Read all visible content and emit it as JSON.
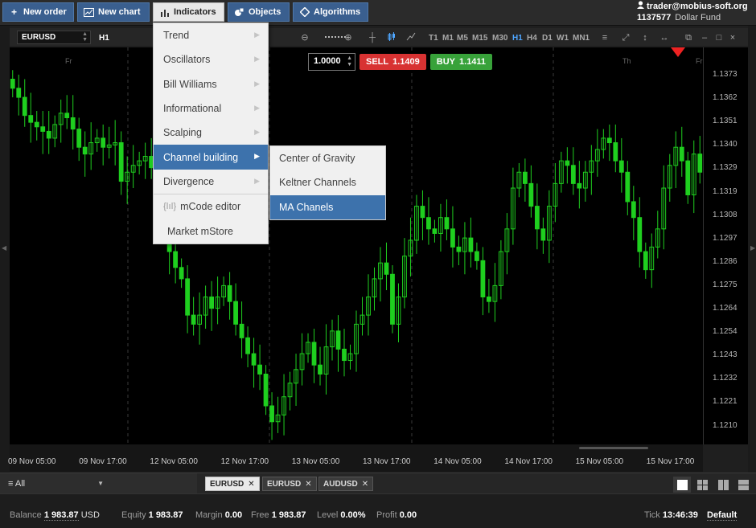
{
  "toolbar": {
    "buttons": [
      {
        "label": "New order",
        "icon": "plus-icon"
      },
      {
        "label": "New chart",
        "icon": "chart-icon"
      },
      {
        "label": "Indicators",
        "icon": "bar-chart-icon"
      },
      {
        "label": "Objects",
        "icon": "objects-icon"
      },
      {
        "label": "Algorithms",
        "icon": "diamond-icon"
      }
    ],
    "user_email": "trader@mobius-soft.org",
    "account_number": "1137577",
    "account_name": "Dollar Fund"
  },
  "chart": {
    "symbol": "EURUSD",
    "timeframe": "H1",
    "timeframes": [
      "T1",
      "M1",
      "M5",
      "M15",
      "M30",
      "H1",
      "H4",
      "D1",
      "W1",
      "MN1"
    ],
    "selected_timeframe": "H1",
    "quantity": "1.0000",
    "sell_label": "SELL",
    "sell_price": "1.1409",
    "buy_label": "BUY",
    "buy_price": "1.1411",
    "price_ticks": [
      "1.1373",
      "1.1362",
      "1.1351",
      "1.1340",
      "1.1329",
      "1.1319",
      "1.1308",
      "1.1297",
      "1.1286",
      "1.1275",
      "1.1264",
      "1.1254",
      "1.1243",
      "1.1232",
      "1.1221",
      "1.1210"
    ],
    "time_ticks": [
      "09 Nov 05:00",
      "09 Nov 17:00",
      "12 Nov 05:00",
      "12 Nov 17:00",
      "13 Nov 05:00",
      "13 Nov 17:00",
      "14 Nov 05:00",
      "14 Nov 17:00",
      "15 Nov 05:00",
      "15 Nov 17:00"
    ],
    "day_labels": [
      "Fr",
      "Th",
      "Fr"
    ],
    "candle_color": "#1fcf1f",
    "background_color": "#000000",
    "sell_color": "#d83232",
    "buy_color": "#38a23a"
  },
  "indicators_menu": {
    "items": [
      {
        "label": "Trend",
        "has_submenu": true
      },
      {
        "label": "Oscillators",
        "has_submenu": true
      },
      {
        "label": "Bill Williams",
        "has_submenu": true
      },
      {
        "label": "Informational",
        "has_submenu": true
      },
      {
        "label": "Scalping",
        "has_submenu": true
      },
      {
        "label": "Channel building",
        "has_submenu": true
      },
      {
        "label": "Divergence",
        "has_submenu": true
      }
    ],
    "highlighted": "Channel building",
    "mcode_label": "mCode editor",
    "mstore_label": "Market mStore",
    "submenu": [
      "Center of Gravity",
      "Keltner Channels",
      "MA Chanels"
    ],
    "submenu_highlighted": "MA Chanels"
  },
  "tabs": {
    "filter": "All",
    "symbols": [
      "EURUSD",
      "EURUSD",
      "AUDUSD"
    ],
    "selected_index": 0
  },
  "status": {
    "balance_label": "Balance",
    "balance": "1 983.87",
    "currency": "USD",
    "equity_label": "Equity",
    "equity": "1 983.87",
    "margin_label": "Margin",
    "margin": "0.00",
    "free_label": "Free",
    "free": "1 983.87",
    "level_label": "Level",
    "level": "0.00%",
    "profit_label": "Profit",
    "profit": "0.00",
    "tick_label": "Tick",
    "tick_time": "13:46:39",
    "profile": "Default"
  },
  "chart_data": {
    "type": "candlestick",
    "candles_close": [
      1.1362,
      1.1358,
      1.135,
      1.1347,
      1.1345,
      1.1343,
      1.134,
      1.1346,
      1.1351,
      1.1349,
      1.1344,
      1.1336,
      1.1333,
      1.1338,
      1.134,
      1.1336,
      1.1337,
      1.1338,
      1.1321,
      1.1325,
      1.1328,
      1.133,
      1.1332,
      1.1327,
      1.1322,
      1.13,
      1.129,
      1.1283,
      1.1278,
      1.1262,
      1.1258,
      1.1262,
      1.127,
      1.1265,
      1.127,
      1.1275,
      1.1268,
      1.1258,
      1.1252,
      1.1245,
      1.124,
      1.1236,
      1.1222,
      1.1215,
      1.1218,
      1.1226,
      1.1232,
      1.1238,
      1.1245,
      1.125,
      1.124,
      1.1236,
      1.1248,
      1.1255,
      1.1247,
      1.1242,
      1.1245,
      1.1258,
      1.1262,
      1.127,
      1.1278,
      1.1285,
      1.128,
      1.1258,
      1.127,
      1.1288,
      1.1295,
      1.131,
      1.1305,
      1.13,
      1.1298,
      1.1305,
      1.13,
      1.1292,
      1.129,
      1.1296,
      1.129,
      1.1286,
      1.127,
      1.1268,
      1.1275,
      1.129,
      1.13,
      1.1318,
      1.1325,
      1.132,
      1.131,
      1.13,
      1.1295,
      1.131,
      1.132,
      1.133,
      1.1328,
      1.132,
      1.1318,
      1.1325,
      1.133,
      1.1335,
      1.134,
      1.1338,
      1.133,
      1.1325,
      1.1312,
      1.1305,
      1.129,
      1.1282,
      1.1292,
      1.13,
      1.1318,
      1.1328,
      1.1336,
      1.133,
      1.1315,
      1.1333,
      1.1325
    ],
    "ylim": [
      1.1205,
      1.138
    ],
    "xlabel": "",
    "ylabel": ""
  }
}
